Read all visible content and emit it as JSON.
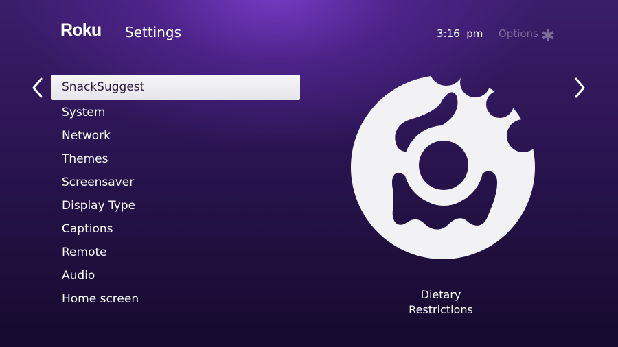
{
  "header": {
    "logo": "Roku",
    "title": "Settings",
    "time": "3:16  pm",
    "options_label": "Options",
    "options_icon": "asterisk-icon"
  },
  "nav": {
    "left_icon": "chevron-left-icon",
    "right_icon": "chevron-right-icon"
  },
  "menu": {
    "selected_index": 0,
    "items": [
      {
        "label": "SnackSuggest"
      },
      {
        "label": "System"
      },
      {
        "label": "Network"
      },
      {
        "label": "Themes"
      },
      {
        "label": "Screensaver"
      },
      {
        "label": "Display Type"
      },
      {
        "label": "Captions"
      },
      {
        "label": "Remote"
      },
      {
        "label": "Audio"
      },
      {
        "label": "Home screen"
      }
    ]
  },
  "preview": {
    "icon": "donut-icon",
    "caption": "Dietary\nRestrictions"
  },
  "colors": {
    "background_top": "#3a1e6a",
    "background_bottom": "#160a2e",
    "accent_glow": "#7a3cc8",
    "selection_bg": "#f0f0f2",
    "selection_text": "#2a1a45"
  }
}
